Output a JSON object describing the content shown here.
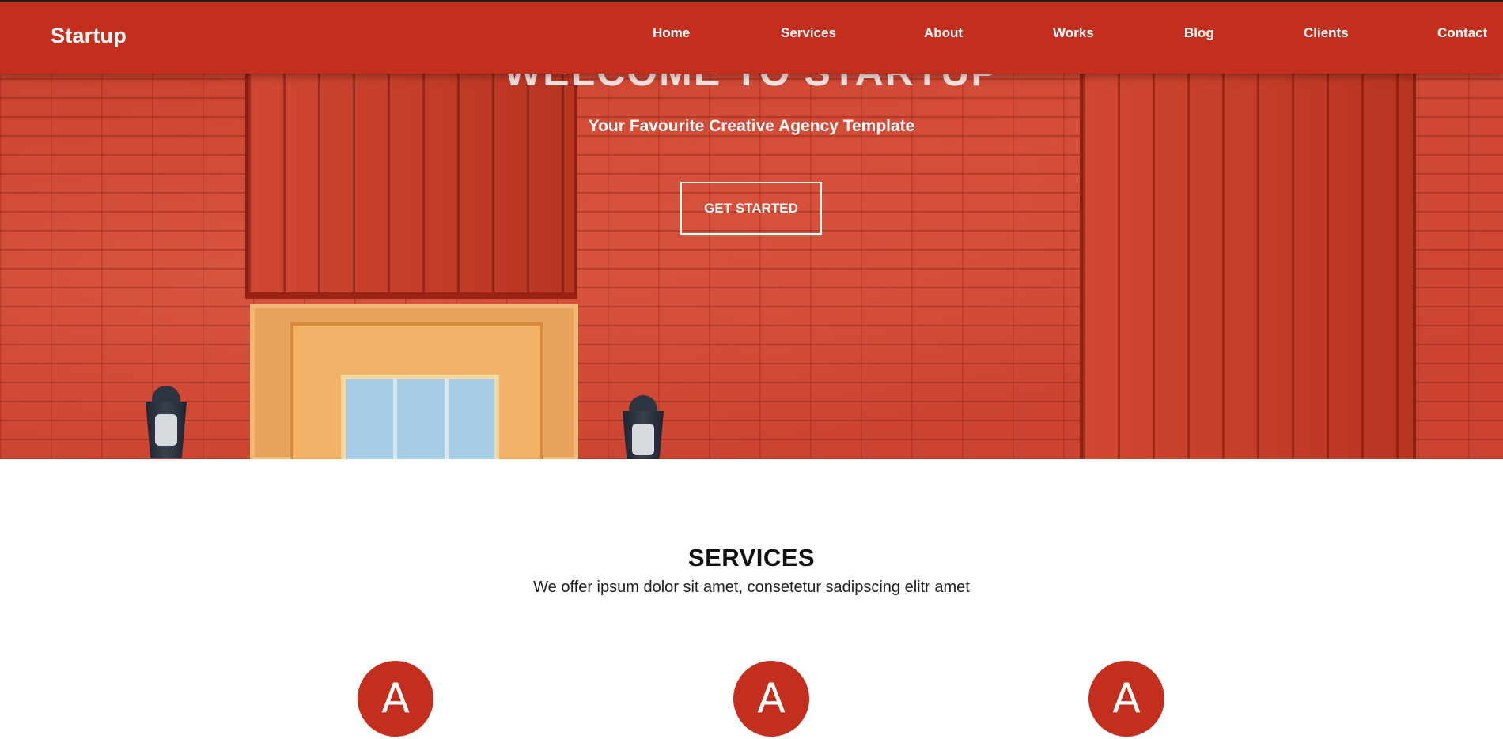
{
  "brand": {
    "name": "Startup"
  },
  "nav": {
    "items": [
      "Home",
      "Services",
      "About",
      "Works",
      "Blog",
      "Clients",
      "Contact"
    ]
  },
  "hero": {
    "title": "WELCOME TO STARTUP",
    "subtitle": "Your Favourite Creative Agency Template",
    "cta_label": "GET STARTED"
  },
  "services": {
    "title": "SERVICES",
    "subtitle": "We offer ipsum dolor sit amet, consetetur sadipscing elitr amet",
    "icons": [
      "A",
      "A",
      "A"
    ]
  },
  "colors": {
    "accent": "#c42f1d",
    "text_dark": "#111111",
    "white": "#ffffff"
  }
}
